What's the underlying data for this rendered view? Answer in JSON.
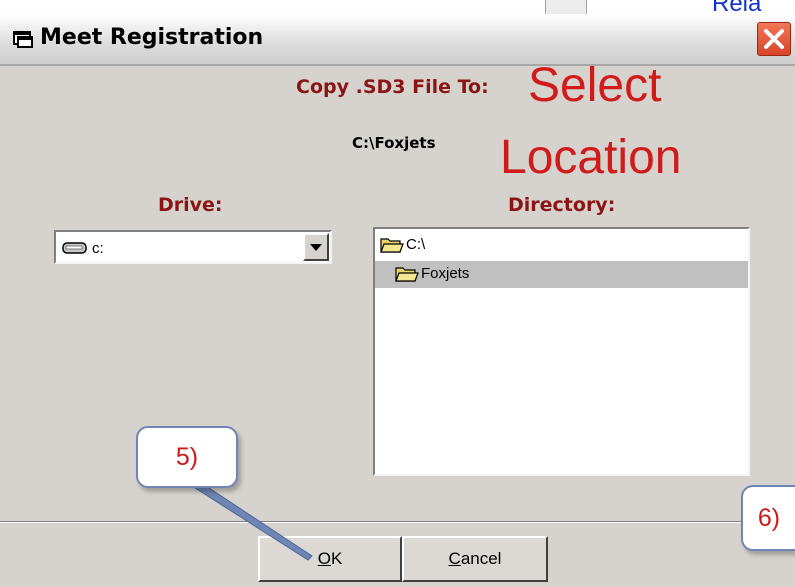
{
  "background": {
    "partial_text": "Rela"
  },
  "dialog": {
    "title": "Meet Registration",
    "copy_label": "Copy .SD3 File To:",
    "copy_path": "C:\\Foxjets",
    "annotation_line1": "Select",
    "annotation_line2": "Location",
    "drive_label": "Drive:",
    "directory_label": "Directory:",
    "drive_value": "c:",
    "directories": [
      {
        "name": "C:\\",
        "selected": false
      },
      {
        "name": "Foxjets",
        "selected": true
      }
    ],
    "ok_button": {
      "mnemonic": "O",
      "rest": "K"
    },
    "cancel_button": {
      "mnemonic": "C",
      "rest": "ancel"
    }
  },
  "callouts": {
    "step5": "5)",
    "step6": "6)"
  },
  "colors": {
    "label_red": "#8b1414",
    "annotation_red": "#d11a1a",
    "callout_border": "#6f85b5"
  }
}
